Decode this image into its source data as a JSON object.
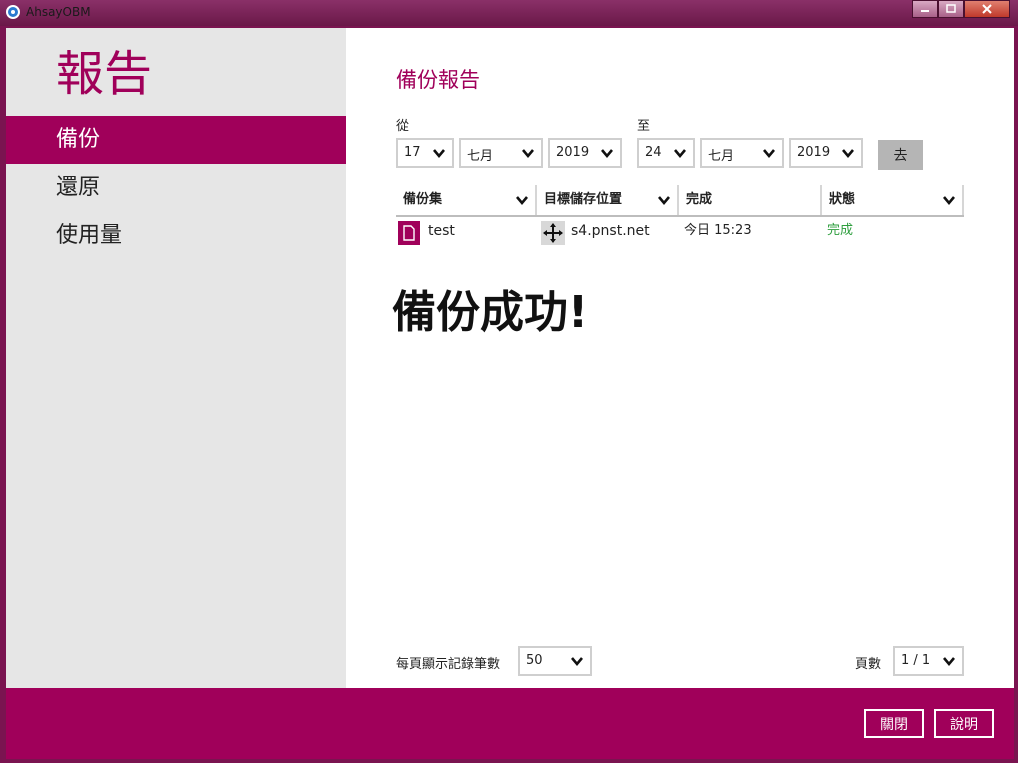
{
  "window": {
    "app_title": "AhsayOBM"
  },
  "sidebar": {
    "title": "報告",
    "items": [
      {
        "label": "備份"
      },
      {
        "label": "還原"
      },
      {
        "label": "使用量"
      }
    ]
  },
  "report": {
    "heading": "備份報告",
    "from_label": "從",
    "to_label": "至",
    "from": {
      "day": "17",
      "month": "七月",
      "year": "2019"
    },
    "to": {
      "day": "24",
      "month": "七月",
      "year": "2019"
    },
    "go_label": "去",
    "columns": [
      "備份集",
      "目標儲存位置",
      "完成",
      "狀態"
    ],
    "rows": [
      {
        "backup_set": "test",
        "destination": "s4.pnst.net",
        "completed": "今日 15:23",
        "status": "完成"
      }
    ],
    "success_message": "備份成功!",
    "per_page_label": "每頁顯示記錄筆數",
    "per_page_value": "50",
    "page_label": "頁數",
    "page_value": "1 / 1"
  },
  "footer": {
    "close_label": "關閉",
    "help_label": "說明"
  },
  "colors": {
    "accent": "#a0005a",
    "status_ok": "#2e9e3e"
  },
  "icons": [
    "app-logo-icon",
    "minimize-icon",
    "maximize-icon",
    "close-icon",
    "chevron-down-icon",
    "file-icon",
    "move-icon"
  ]
}
